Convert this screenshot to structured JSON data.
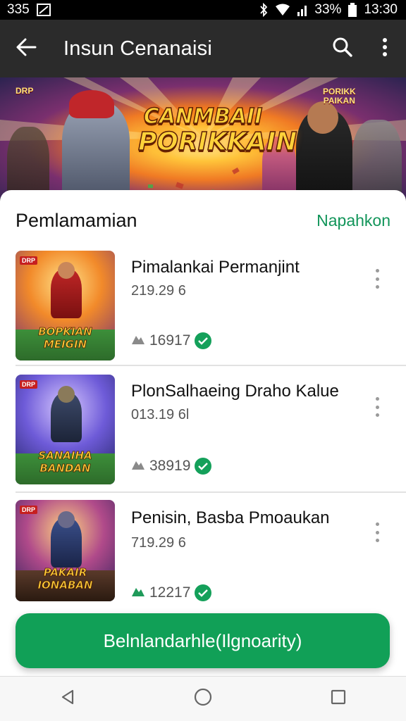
{
  "status_bar": {
    "left_text": "335",
    "battery": "33%",
    "time": "13:30"
  },
  "app_bar": {
    "title": "Insun Cenanaisi"
  },
  "banner": {
    "title_line1": "CANMBAII",
    "title_line2": "PORIKKAIN",
    "tag_left": "DRP",
    "tag_right_line1": "PORIKK",
    "tag_right_line2": "PAIKAN"
  },
  "section": {
    "title": "Pemlamamian",
    "see_all": "Napahkon"
  },
  "items": [
    {
      "name": "Pimalankai Permanjint",
      "price": "219.29 6",
      "count": "16917",
      "thumb_title_line1": "BOPKIAN",
      "thumb_title_line2": "MEIGIN",
      "thumb_badge": "DRP"
    },
    {
      "name": "PlonSalhaeing Draho Kalue",
      "price": "013.19 6l",
      "count": "38919",
      "thumb_title_line1": "SANAIHA",
      "thumb_title_line2": "BANDAN",
      "thumb_badge": "DRP"
    },
    {
      "name": "Penisin, Basba Pmoaukan",
      "price": "719.29 6",
      "count": "12217",
      "thumb_title_line1": "PAKAIR",
      "thumb_title_line2": "IONABAN",
      "thumb_badge": "DRP"
    }
  ],
  "cta": {
    "label": "Belnlandarhle(Ilgnoarity)"
  },
  "colors": {
    "accent": "#12955a",
    "cta": "#11a057",
    "appbar": "#2b2b2b"
  }
}
